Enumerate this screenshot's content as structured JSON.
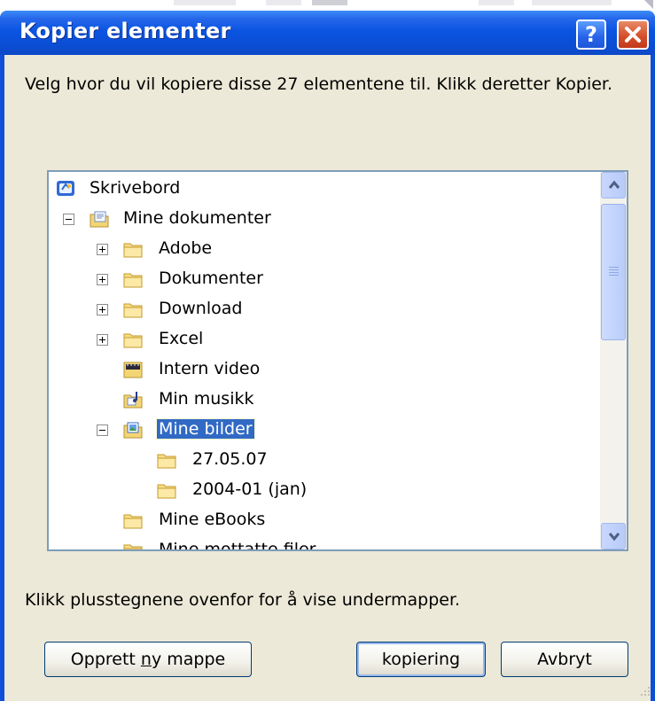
{
  "dialog": {
    "title": "Kopier elementer",
    "instruction": "Velg hvor du vil kopiere disse 27 elementene til. Klikk deretter Kopier.",
    "hint": "Klikk plusstegnene ovenfor for å vise undermapper."
  },
  "tree": {
    "items": [
      {
        "label": "Skrivebord",
        "icon": "desktop-icon",
        "expander": "none"
      },
      {
        "label": "Mine dokumenter",
        "icon": "my-documents-icon",
        "expander": "minus"
      },
      {
        "label": "Adobe",
        "icon": "folder-icon",
        "expander": "plus"
      },
      {
        "label": "Dokumenter",
        "icon": "folder-icon",
        "expander": "plus"
      },
      {
        "label": "Download",
        "icon": "folder-icon",
        "expander": "plus"
      },
      {
        "label": "Excel",
        "icon": "folder-icon",
        "expander": "plus"
      },
      {
        "label": "Intern video",
        "icon": "video-folder-icon",
        "expander": "none"
      },
      {
        "label": "Min musikk",
        "icon": "music-folder-icon",
        "expander": "none"
      },
      {
        "label": "Mine bilder",
        "icon": "pictures-folder-icon",
        "expander": "minus",
        "selected": true
      },
      {
        "label": "27.05.07",
        "icon": "folder-icon",
        "expander": "none"
      },
      {
        "label": "2004-01 (jan)",
        "icon": "folder-icon",
        "expander": "none"
      },
      {
        "label": "Mine eBooks",
        "icon": "folder-icon",
        "expander": "none"
      },
      {
        "label": "Mine mottatte filer",
        "icon": "folder-icon",
        "expander": "none"
      }
    ]
  },
  "buttons": {
    "new_folder_pre": "Opprett ",
    "new_folder_accel": "n",
    "new_folder_post": "y mappe",
    "copy": "kopiering",
    "cancel": "Avbryt"
  },
  "titlebar_buttons": {
    "help": "?"
  },
  "colors": {
    "titlebar": "#0a4fd8",
    "selection": "#316ac5",
    "dialog_bg": "#ece9d8"
  }
}
